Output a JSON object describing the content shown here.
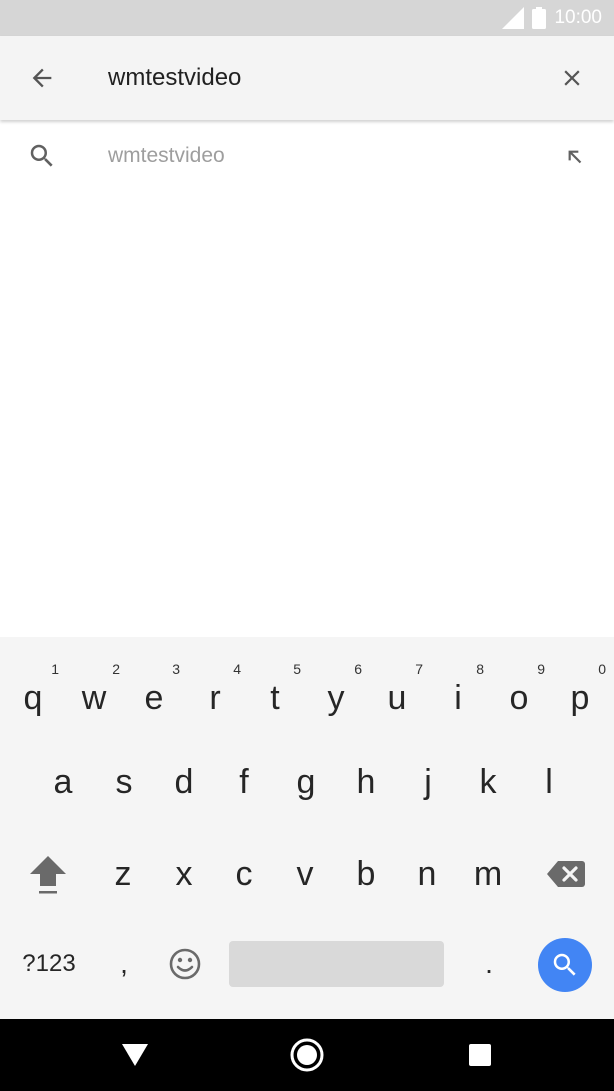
{
  "status_bar": {
    "time": "10:00",
    "signal_icon": "cell-signal-icon",
    "battery_icon": "battery-icon"
  },
  "search": {
    "query": "wmtestvideo",
    "back_icon": "arrow-left-icon",
    "clear_icon": "close-icon"
  },
  "suggestions": [
    {
      "text": "wmtestvideo",
      "icon": "search-icon",
      "action_icon": "arrow-up-left-icon"
    }
  ],
  "keyboard": {
    "row1": [
      {
        "key": "q",
        "hint": "1"
      },
      {
        "key": "w",
        "hint": "2"
      },
      {
        "key": "e",
        "hint": "3"
      },
      {
        "key": "r",
        "hint": "4"
      },
      {
        "key": "t",
        "hint": "5"
      },
      {
        "key": "y",
        "hint": "6"
      },
      {
        "key": "u",
        "hint": "7"
      },
      {
        "key": "i",
        "hint": "8"
      },
      {
        "key": "o",
        "hint": "9"
      },
      {
        "key": "p",
        "hint": "0"
      }
    ],
    "row2": [
      "a",
      "s",
      "d",
      "f",
      "g",
      "h",
      "j",
      "k",
      "l"
    ],
    "row3": [
      "z",
      "x",
      "c",
      "v",
      "b",
      "n",
      "m"
    ],
    "symbols_label": "?123",
    "comma": ",",
    "period": ".",
    "accent": "#4285f4"
  },
  "nav_bar": {
    "back_icon": "nav-back-icon",
    "home_icon": "nav-home-icon",
    "recents_icon": "nav-recents-icon"
  }
}
